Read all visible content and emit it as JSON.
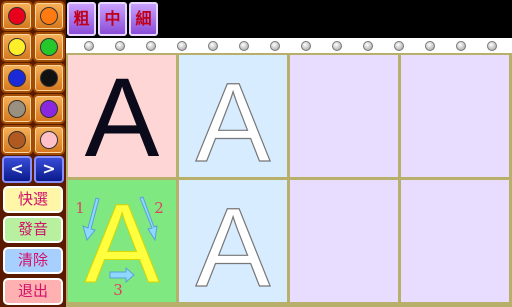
{
  "palette": {
    "colors": [
      {
        "name": "red",
        "hex": "#e8001c"
      },
      {
        "name": "orange",
        "hex": "#ff7a10"
      },
      {
        "name": "yellow",
        "hex": "#ffee2a"
      },
      {
        "name": "green",
        "hex": "#25c82a"
      },
      {
        "name": "blue",
        "hex": "#1a2ad8"
      },
      {
        "name": "black",
        "hex": "#111111"
      },
      {
        "name": "gray",
        "hex": "#9a9080"
      },
      {
        "name": "purple",
        "hex": "#8a28e0"
      },
      {
        "name": "brown",
        "hex": "#b05a22"
      },
      {
        "name": "pink",
        "hex": "#ffc0c8"
      }
    ],
    "prev_label": "<",
    "next_label": ">",
    "actions": [
      {
        "label": "快選",
        "bg": "#fff6a8",
        "fg": "#d0106a"
      },
      {
        "label": "發音",
        "bg": "#b8f0a0",
        "fg": "#d0106a"
      },
      {
        "label": "清除",
        "bg": "#a8d0ff",
        "fg": "#d0106a"
      },
      {
        "label": "退出",
        "bg": "#ffb0b0",
        "fg": "#d0106a"
      }
    ]
  },
  "toolbar": {
    "thick_label": "粗",
    "medium_label": "中",
    "thin_label": "細"
  },
  "cells": [
    {
      "bg": "#ffd6d6",
      "letter": "A",
      "style": "solid",
      "color": "#0a0a1a"
    },
    {
      "bg": "#d8ecff",
      "letter": "A",
      "style": "outline",
      "color": "#ffffff"
    },
    {
      "bg": "#e8dcff",
      "letter": "",
      "style": "empty"
    },
    {
      "bg": "#e8dcff",
      "letter": "",
      "style": "empty"
    },
    {
      "bg": "#80e880",
      "letter": "A",
      "style": "guided",
      "color": "#ffff40",
      "stroke_numbers": [
        "1",
        "2",
        "3"
      ]
    },
    {
      "bg": "#d8ecff",
      "letter": "A",
      "style": "outline",
      "color": "#ffffff"
    },
    {
      "bg": "#e8dcff",
      "letter": "",
      "style": "empty"
    },
    {
      "bg": "#e8dcff",
      "letter": "",
      "style": "empty"
    }
  ]
}
